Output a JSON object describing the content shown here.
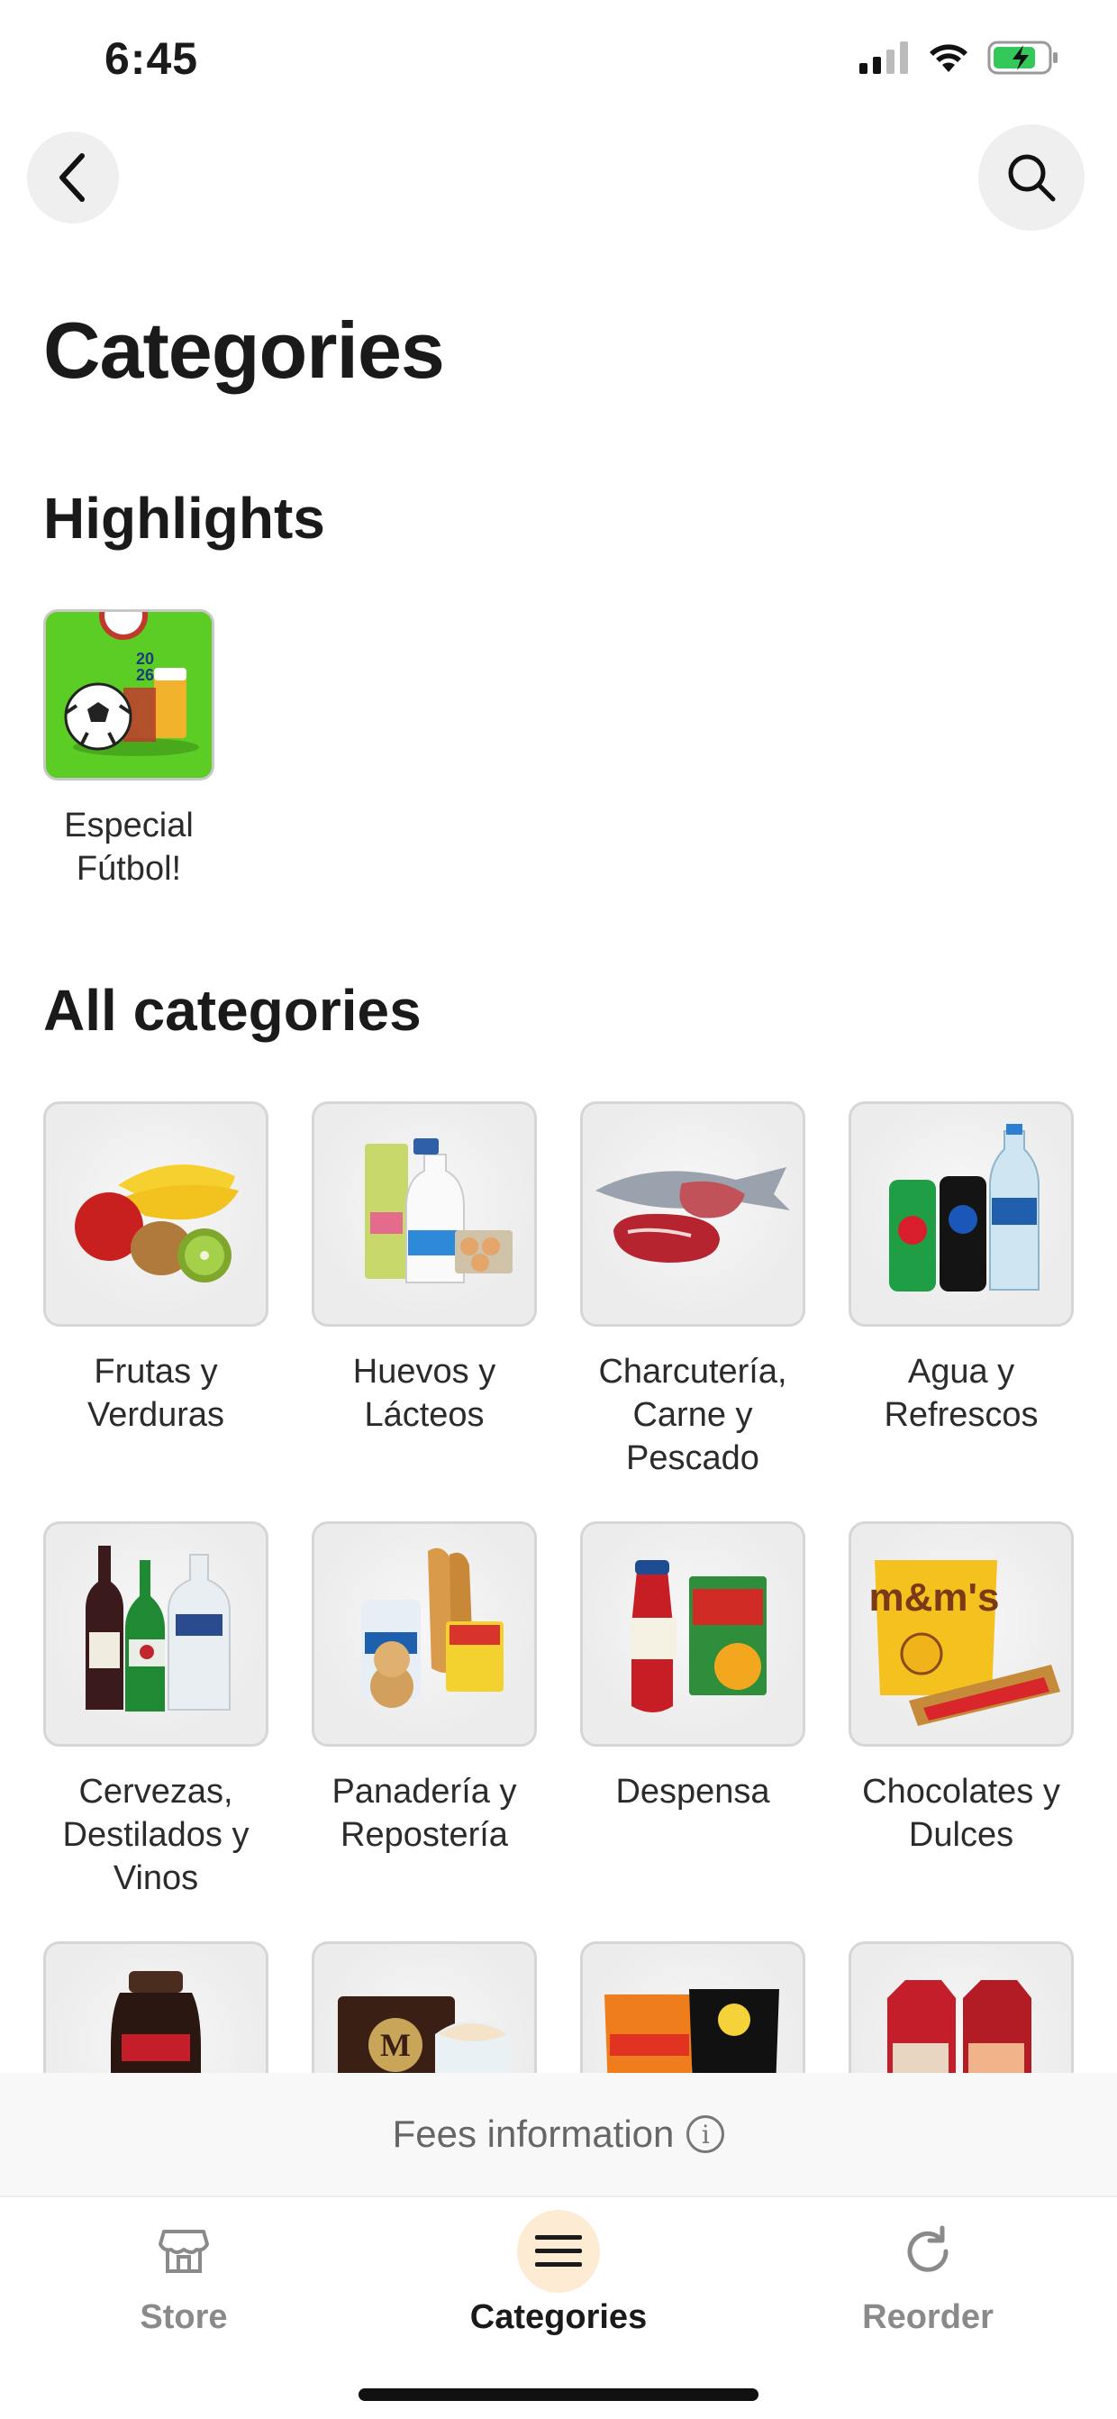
{
  "status_bar": {
    "time": "6:45"
  },
  "nav": {
    "back_icon": "chevron-left-icon",
    "search_icon": "search-icon"
  },
  "page_title": "Categories",
  "highlights": {
    "title": "Highlights",
    "items": [
      {
        "label": "Especial Fútbol!"
      }
    ]
  },
  "all_categories": {
    "title": "All categories",
    "items": [
      {
        "label": "Frutas y Verduras"
      },
      {
        "label": "Huevos y Lácteos"
      },
      {
        "label": "Charcutería, Carne y Pescado"
      },
      {
        "label": "Agua y Refrescos"
      },
      {
        "label": "Cervezas, Destilados y Vinos"
      },
      {
        "label": "Panadería y Repostería"
      },
      {
        "label": "Despensa"
      },
      {
        "label": "Chocolates y Dulces"
      },
      {
        "label": ""
      },
      {
        "label": ""
      },
      {
        "label": ""
      },
      {
        "label": ""
      }
    ]
  },
  "fees": {
    "text": "Fees information"
  },
  "tab_bar": {
    "tabs": [
      {
        "label": "Store",
        "icon": "store-icon"
      },
      {
        "label": "Categories",
        "icon": "menu-icon",
        "active": true
      },
      {
        "label": "Reorder",
        "icon": "refresh-icon"
      }
    ]
  },
  "colors": {
    "active_tab_bg": "#fdebd4",
    "highlight_bg": "#5ccd24"
  }
}
